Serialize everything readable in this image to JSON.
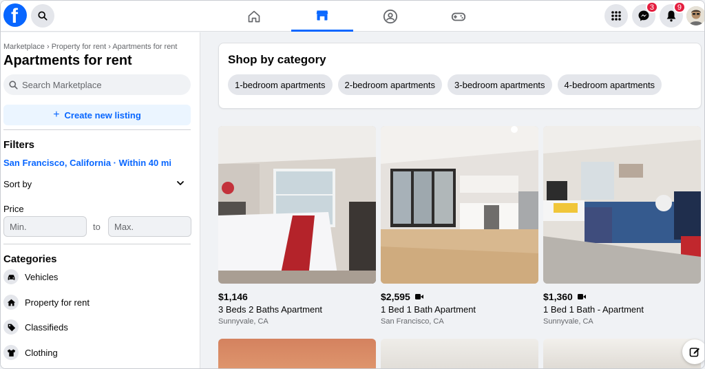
{
  "topbar": {
    "logo": "facebook-logo",
    "logo_letter": "f",
    "nav_tabs": [
      {
        "name": "home",
        "icon": "home-icon"
      },
      {
        "name": "marketplace",
        "icon": "marketplace-icon",
        "active": true
      },
      {
        "name": "groups",
        "icon": "groups-icon"
      },
      {
        "name": "gaming",
        "icon": "gaming-icon"
      }
    ],
    "messenger_badge": "3",
    "notifications_badge": "9"
  },
  "sidebar": {
    "breadcrumb": "Marketplace › Property for rent › Apartments for rent",
    "title": "Apartments for rent",
    "search_placeholder": "Search Marketplace",
    "create_label": "Create new listing",
    "filters_heading": "Filters",
    "location": "San Francisco, California · Within 40 mi",
    "sort_label": "Sort by",
    "price_label": "Price",
    "min_placeholder": "Min.",
    "to_label": "to",
    "max_placeholder": "Max.",
    "categories_heading": "Categories",
    "categories": [
      {
        "label": "Vehicles",
        "icon": "car-icon"
      },
      {
        "label": "Property for rent",
        "icon": "house-icon"
      },
      {
        "label": "Classifieds",
        "icon": "tag-icon"
      },
      {
        "label": "Clothing",
        "icon": "shirt-icon"
      }
    ]
  },
  "main": {
    "shop_title": "Shop by category",
    "chips": [
      "1-bedroom apartments",
      "2-bedroom apartments",
      "3-bedroom apartments",
      "4-bedroom apartments"
    ],
    "listings": [
      {
        "price": "$1,146",
        "title": "3 Beds 2 Baths Apartment",
        "location": "Sunnyvale, CA",
        "video": false
      },
      {
        "price": "$2,595",
        "title": "1 Bed 1 Bath Apartment",
        "location": "San Francisco, CA",
        "video": true
      },
      {
        "price": "$1,360",
        "title": "1 Bed 1 Bath - Apartment",
        "location": "Sunnyvale, CA",
        "video": true
      }
    ]
  },
  "colors": {
    "brand_blue": "#0866ff",
    "badge_red": "#e41e3f",
    "background": "#f0f2f5"
  }
}
